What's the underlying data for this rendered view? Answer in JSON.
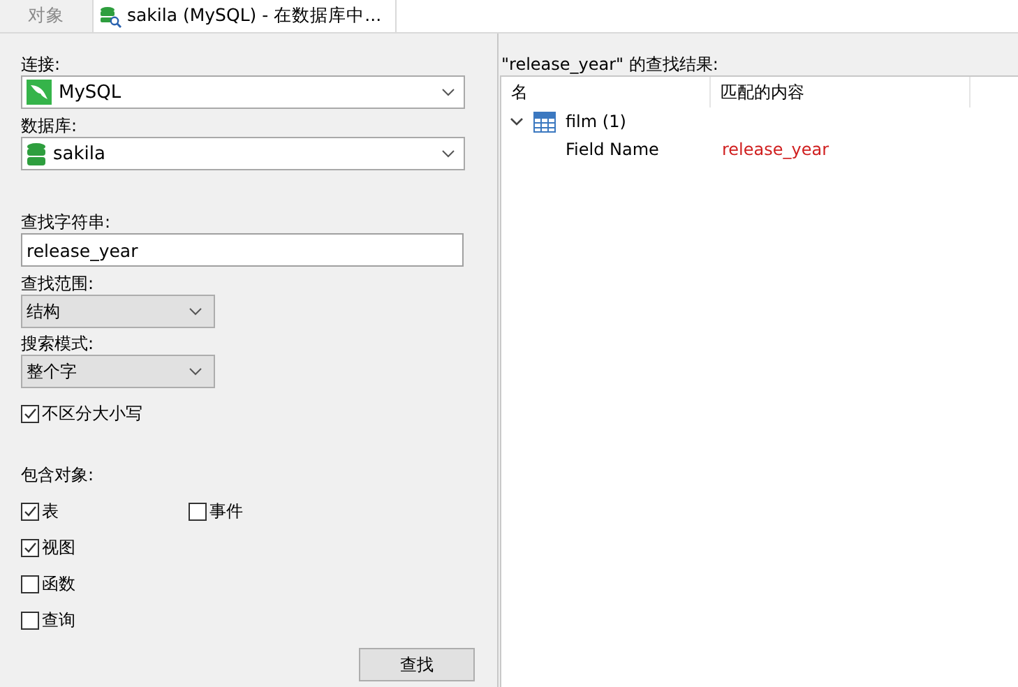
{
  "tabs": [
    {
      "label": "对象",
      "selected": false
    },
    {
      "label": "sakila (MySQL) - 在数据库中...",
      "selected": true
    }
  ],
  "form": {
    "connection": {
      "label": "连接:",
      "value": "MySQL"
    },
    "database": {
      "label": "数据库:",
      "value": "sakila"
    },
    "search_string": {
      "label": "查找字符串:",
      "value": "release_year"
    },
    "scope": {
      "label": "查找范围:",
      "value": "结构"
    },
    "mode": {
      "label": "搜索模式:",
      "value": "整个字"
    },
    "case_insensitive": {
      "label": "不区分大小写",
      "checked": true
    },
    "objects_label": "包含对象:",
    "objects": [
      {
        "label": "表",
        "checked": true
      },
      {
        "label": "视图",
        "checked": true
      },
      {
        "label": "函数",
        "checked": false
      },
      {
        "label": "查询",
        "checked": false
      },
      {
        "label": "事件",
        "checked": false
      }
    ],
    "find_button": "查找"
  },
  "results": {
    "title": "\"release_year\" 的查找结果:",
    "columns": [
      "名",
      "匹配的内容"
    ],
    "tree": [
      {
        "label": "film (1)",
        "expanded": true,
        "children": [
          {
            "label": "Field Name",
            "match": "release_year"
          }
        ]
      }
    ]
  }
}
